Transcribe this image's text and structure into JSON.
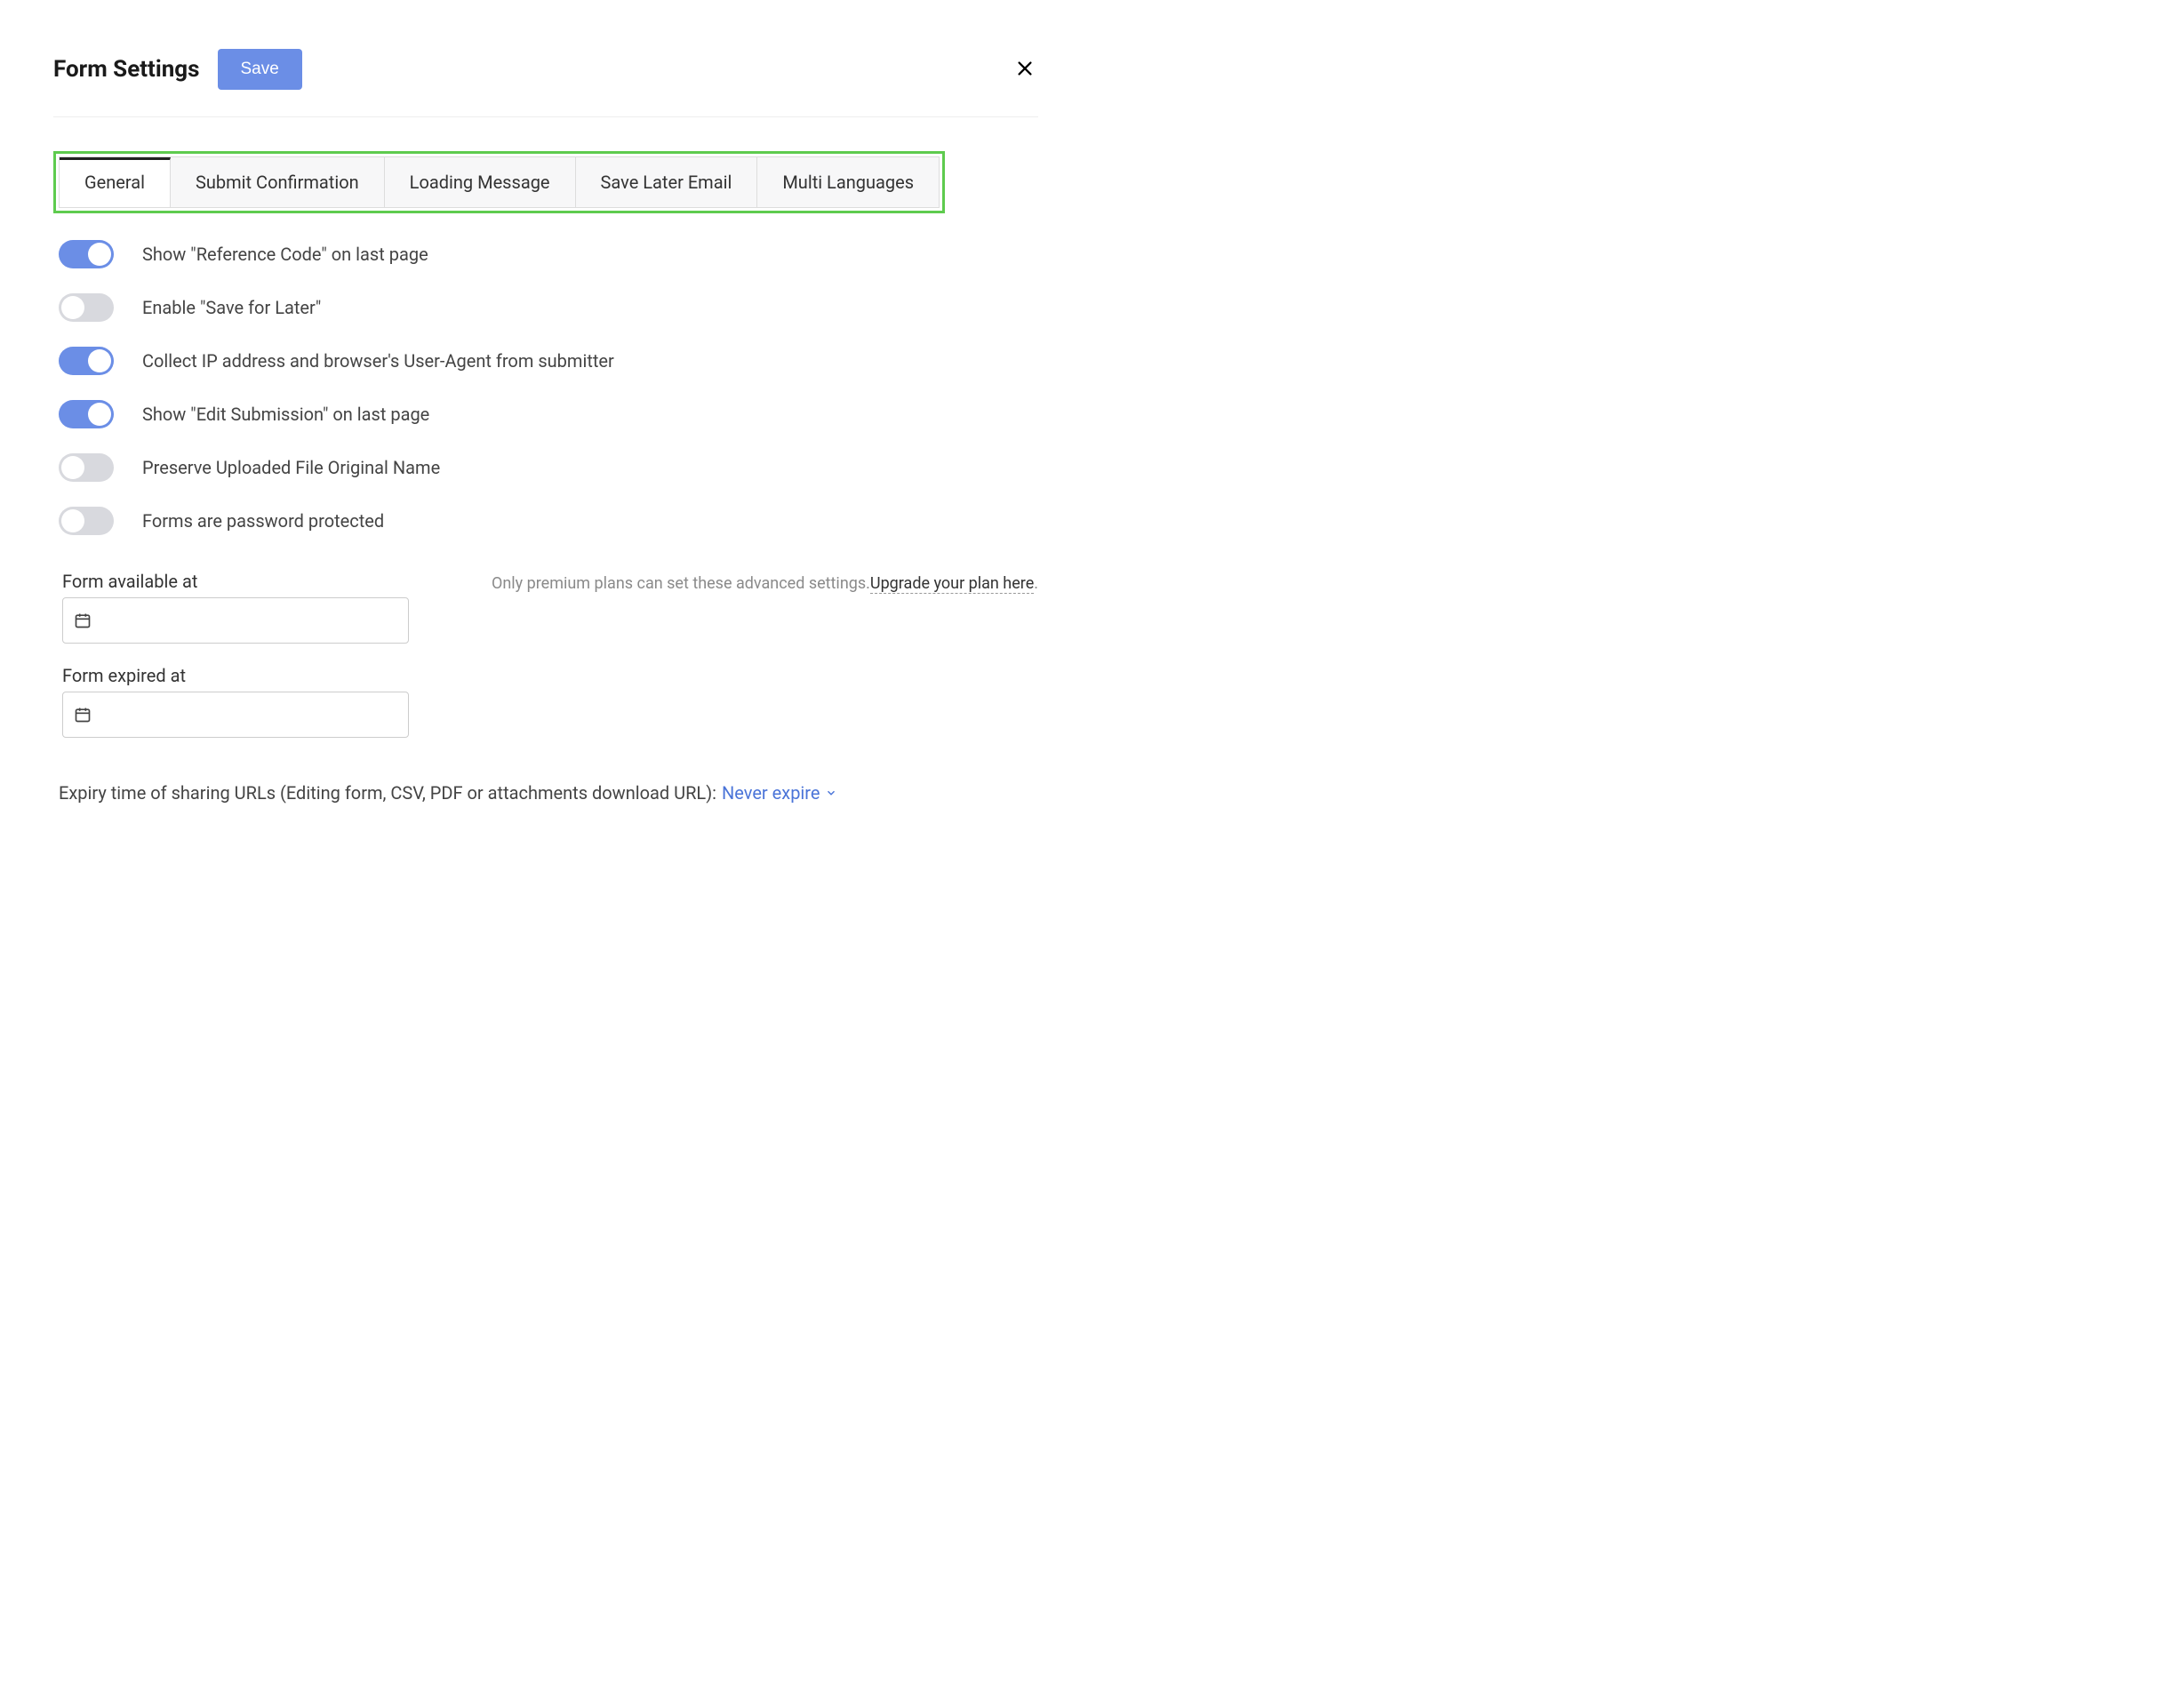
{
  "header": {
    "title": "Form Settings",
    "save_label": "Save"
  },
  "tabs": [
    {
      "label": "General",
      "active": true
    },
    {
      "label": "Submit Confirmation",
      "active": false
    },
    {
      "label": "Loading Message",
      "active": false
    },
    {
      "label": "Save Later Email",
      "active": false
    },
    {
      "label": "Multi Languages",
      "active": false
    }
  ],
  "settings": [
    {
      "label": "Show \"Reference Code\" on last page",
      "on": true
    },
    {
      "label": "Enable \"Save for Later\"",
      "on": false
    },
    {
      "label": "Collect IP address and browser's User-Agent from submitter",
      "on": true
    },
    {
      "label": "Show \"Edit Submission\" on last page",
      "on": true
    },
    {
      "label": "Preserve Uploaded File Original Name",
      "on": false
    },
    {
      "label": "Forms are password protected",
      "on": false
    }
  ],
  "date_fields": {
    "available_label": "Form available at",
    "available_value": "",
    "expired_label": "Form expired at",
    "expired_value": ""
  },
  "premium": {
    "note": "Only premium plans can set these advanced settings.",
    "upgrade_link": "Upgrade your plan here",
    "period": "."
  },
  "expiry": {
    "label": "Expiry time of sharing URLs (Editing form, CSV, PDF or attachments download URL):",
    "selected": "Never expire"
  }
}
